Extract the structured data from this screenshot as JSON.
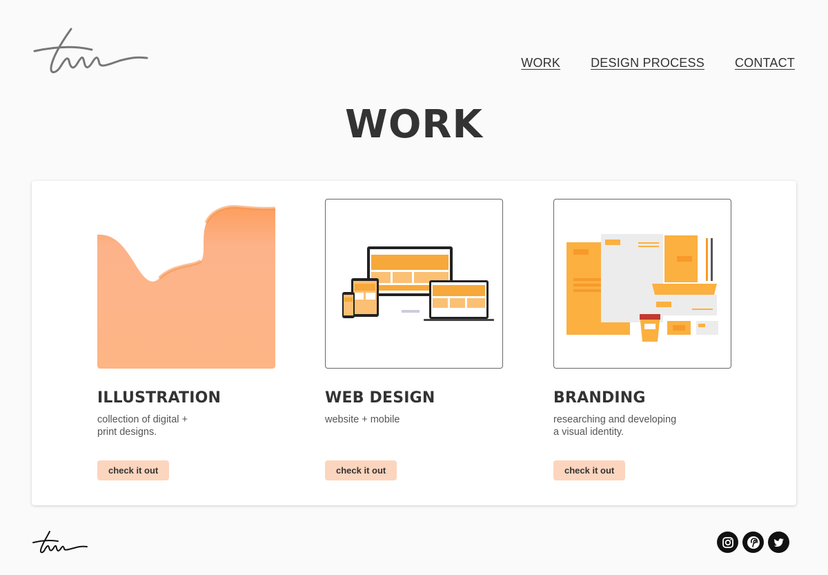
{
  "header": {
    "nav": [
      {
        "label": "WORK"
      },
      {
        "label": "DESIGN PROCESS"
      },
      {
        "label": "CONTACT"
      }
    ]
  },
  "main": {
    "title": "WORK",
    "cards": [
      {
        "title": "ILLUSTRATION",
        "description": "collection of digital +\nprint designs.",
        "cta": "check it out"
      },
      {
        "title": "WEB DESIGN",
        "description": "website + mobile",
        "cta": "check it out"
      },
      {
        "title": "BRANDING",
        "description": "researching and developing\na visual identity.",
        "cta": "check it out"
      }
    ]
  },
  "footer": {
    "social": [
      "instagram-icon",
      "pinterest-icon",
      "twitter-icon"
    ]
  },
  "colors": {
    "accent_orange": "#fbb040",
    "peach": "#fdb38a",
    "button_bg": "#fcd5be",
    "text": "#333333"
  }
}
